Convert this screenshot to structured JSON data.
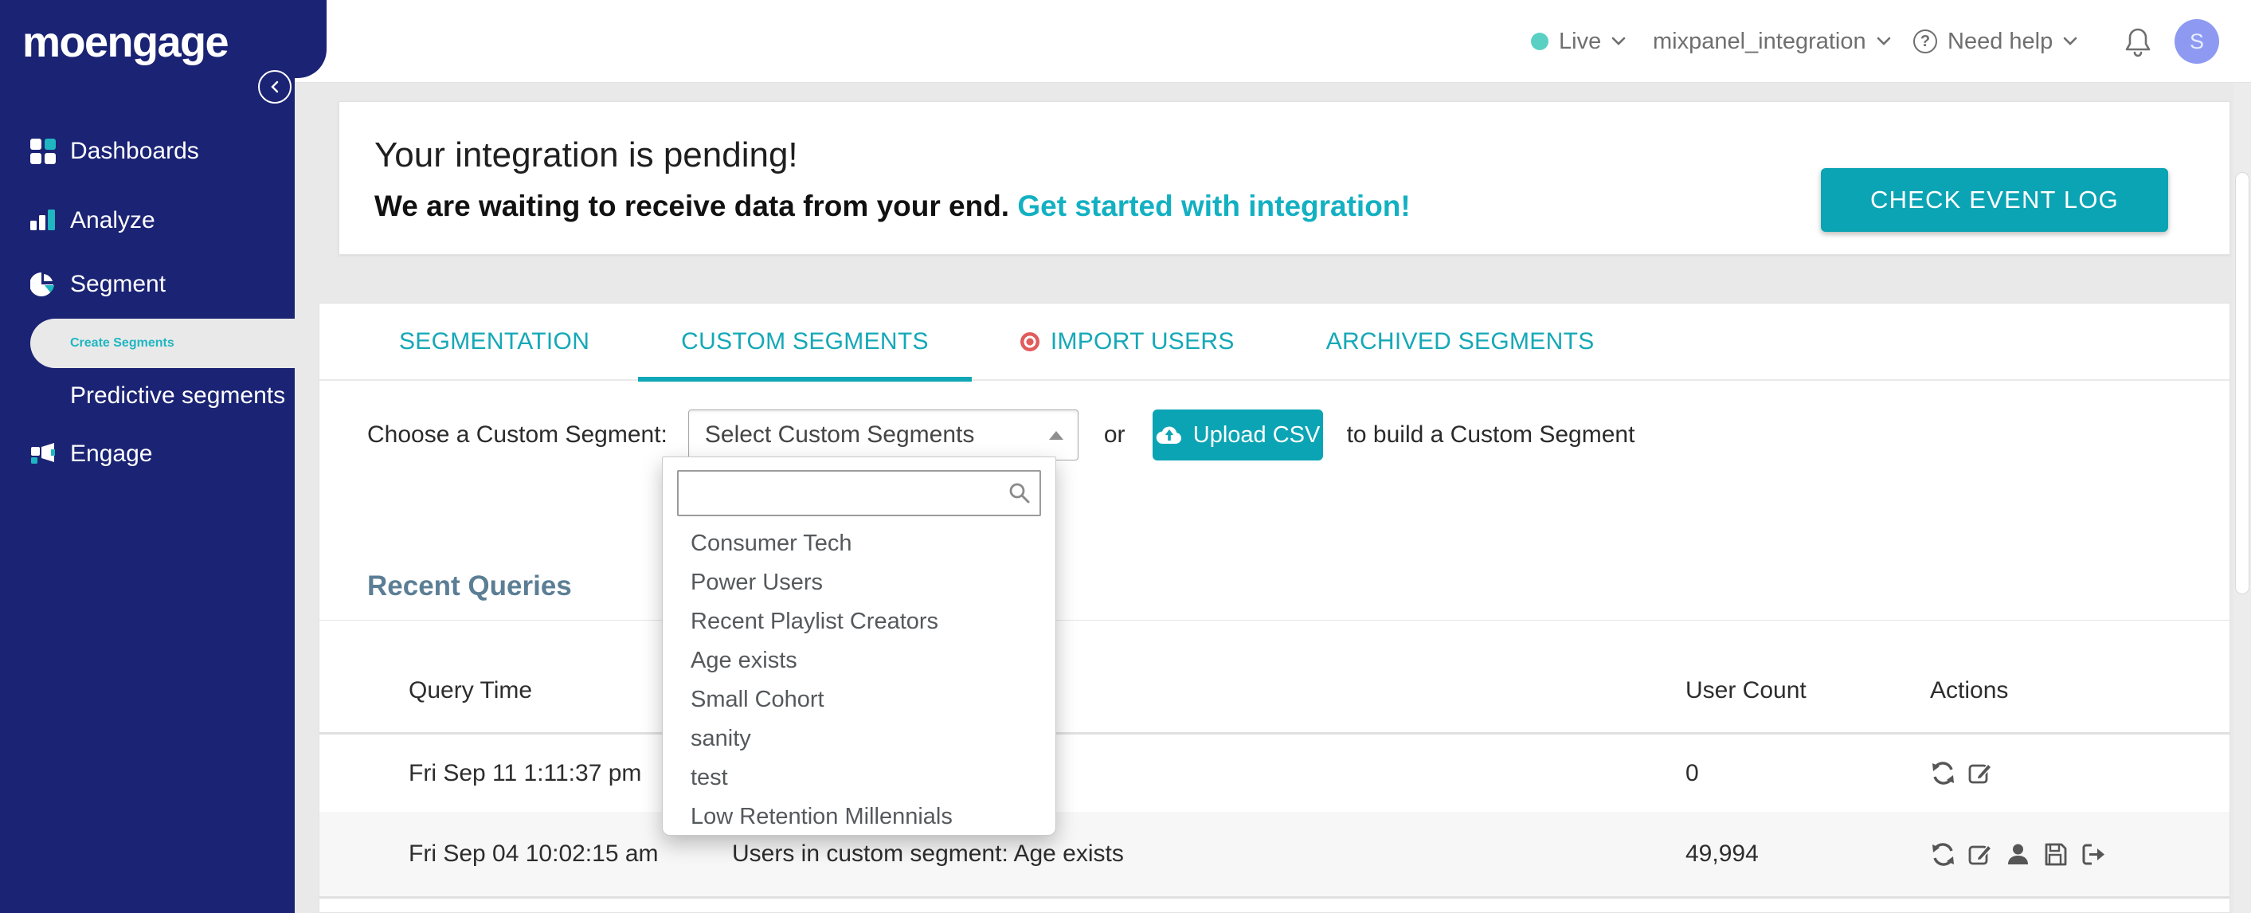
{
  "logo_text": "moengage",
  "topbar": {
    "env_label": "Live",
    "workspace": "mixpanel_integration",
    "help_label": "Need help",
    "avatar_initial": "S"
  },
  "sidebar": {
    "items": [
      {
        "label": "Dashboards",
        "icon": "grid-icon",
        "active": false
      },
      {
        "label": "Analyze",
        "icon": "bar-chart-icon",
        "active": false
      },
      {
        "label": "Segment",
        "icon": "pie-chart-icon",
        "active": false
      },
      {
        "label": "Create Segments",
        "icon": null,
        "child": true,
        "active": true
      },
      {
        "label": "Predictive segments",
        "icon": null,
        "child": true,
        "active": false
      },
      {
        "label": "Engage",
        "icon": "megaphone-icon",
        "active": false
      }
    ]
  },
  "banner": {
    "title": "Your integration is pending!",
    "subtitle": "We are waiting to receive data from your end.",
    "link_text": "Get started with integration!",
    "button_label": "CHECK EVENT LOG"
  },
  "tabs": [
    {
      "label": "SEGMENTATION",
      "active": false
    },
    {
      "label": "CUSTOM SEGMENTS",
      "active": true
    },
    {
      "label": "IMPORT USERS",
      "active": false,
      "badge": "red-ring-dot"
    },
    {
      "label": "ARCHIVED SEGMENTS",
      "active": false
    }
  ],
  "chooser": {
    "label": "Choose a Custom Segment:",
    "select_value": "Select Custom Segments",
    "conjunction": "or",
    "upload_button_label": "Upload CSV",
    "suffix_text": "to build a Custom Segment"
  },
  "dropdown": {
    "search_value": "",
    "options": [
      "Consumer Tech",
      "Power Users",
      "Recent Playlist Creators",
      "Age exists",
      "Small Cohort",
      "sanity",
      "test",
      "Low Retention Millennials"
    ]
  },
  "recent_queries": {
    "title": "Recent Queries",
    "columns": {
      "time": "Query Time",
      "user_count": "User Count",
      "actions": "Actions"
    },
    "rows": [
      {
        "time": "Fri Sep 11 1:11:37 pm",
        "query": "",
        "user_count": "0",
        "actions": [
          "refresh",
          "edit"
        ]
      },
      {
        "time": "Fri Sep 04 10:02:15 am",
        "query": "Users in custom segment: Age exists",
        "user_count": "49,994",
        "actions": [
          "refresh",
          "edit",
          "user",
          "save",
          "export"
        ]
      }
    ]
  },
  "colors": {
    "sidebar_navy": "#1b2374",
    "accent_teal": "#0ba4b4",
    "link_teal": "#13b0c2",
    "active_nav_teal": "#1fb6c1",
    "heading_slate": "#5b7e95",
    "import_users_red": "#e15c5c",
    "avatar_periwinkle": "#8e9af2",
    "live_dot_teal": "#5ad0c4",
    "row_alt_bg": "#f7f7f7",
    "page_bg": "#e9e9e9"
  }
}
